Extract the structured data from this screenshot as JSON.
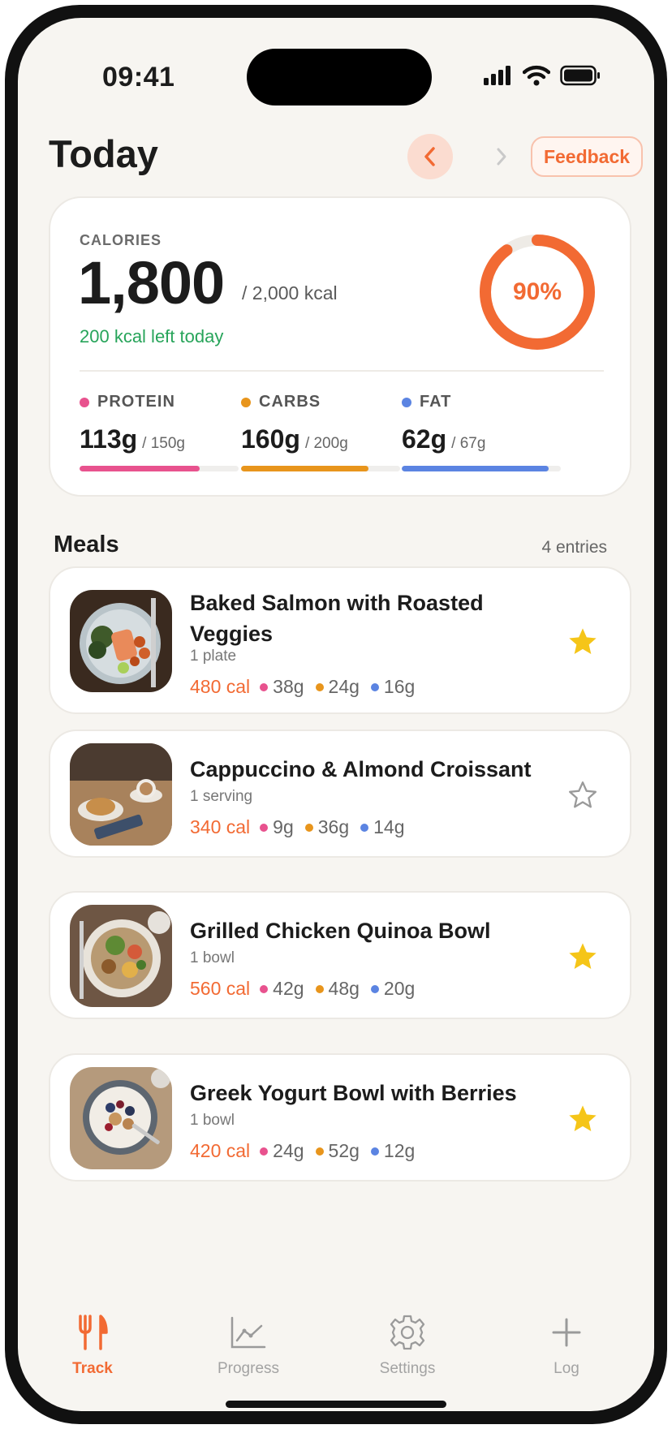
{
  "status_bar": {
    "time": "09:41"
  },
  "header": {
    "title": "Today",
    "feedback_label": "Feedback"
  },
  "summary": {
    "calories_label": "CALORIES",
    "calories_value": "1,800",
    "calories_goal": "/ 2,000 kcal",
    "calories_left": "200 kcal left today",
    "progress_label": "90%",
    "progress_fraction": 0.9,
    "macros": [
      {
        "label": "PROTEIN",
        "value": "113g",
        "goal": "/ 150g",
        "fraction": 0.753,
        "color": "#e8528e"
      },
      {
        "label": "CARBS",
        "value": "160g",
        "goal": "/ 200g",
        "fraction": 0.8,
        "color": "#e8951c"
      },
      {
        "label": "FAT",
        "value": "62g",
        "goal": "/ 67g",
        "fraction": 0.925,
        "color": "#5b84e2"
      }
    ]
  },
  "meals": {
    "title": "Meals",
    "count": "4 entries",
    "items": [
      {
        "name": "Baked Salmon with Roasted Veggies",
        "portion": "1 plate",
        "kcal": "480 cal",
        "protein": "38g",
        "carbs": "24g",
        "fat": "16g",
        "favorite": true
      },
      {
        "name": "Cappuccino & Almond Croissant",
        "portion": "1 serving",
        "kcal": "340 cal",
        "protein": "9g",
        "carbs": "36g",
        "fat": "14g",
        "favorite": false
      },
      {
        "name": "Grilled Chicken Quinoa Bowl",
        "portion": "1 bowl",
        "kcal": "560 cal",
        "protein": "42g",
        "carbs": "48g",
        "fat": "20g",
        "favorite": true
      },
      {
        "name": "Greek Yogurt Bowl with Berries",
        "portion": "1 bowl",
        "kcal": "420 cal",
        "protein": "24g",
        "carbs": "52g",
        "fat": "12g",
        "favorite": true
      }
    ]
  },
  "tab_bar": {
    "tabs": [
      {
        "label": "Track",
        "icon": "fork-knife-icon",
        "active": true
      },
      {
        "label": "Progress",
        "icon": "chart-icon",
        "active": false
      },
      {
        "label": "Settings",
        "icon": "gear-icon",
        "active": false
      },
      {
        "label": "Log",
        "icon": "plus-icon",
        "active": false
      }
    ]
  },
  "colors": {
    "accent": "#f26a33",
    "protein": "#e8528e",
    "carbs": "#e8951c",
    "fat": "#5b84e2",
    "success": "#27a45a",
    "star": "#f5c518"
  }
}
